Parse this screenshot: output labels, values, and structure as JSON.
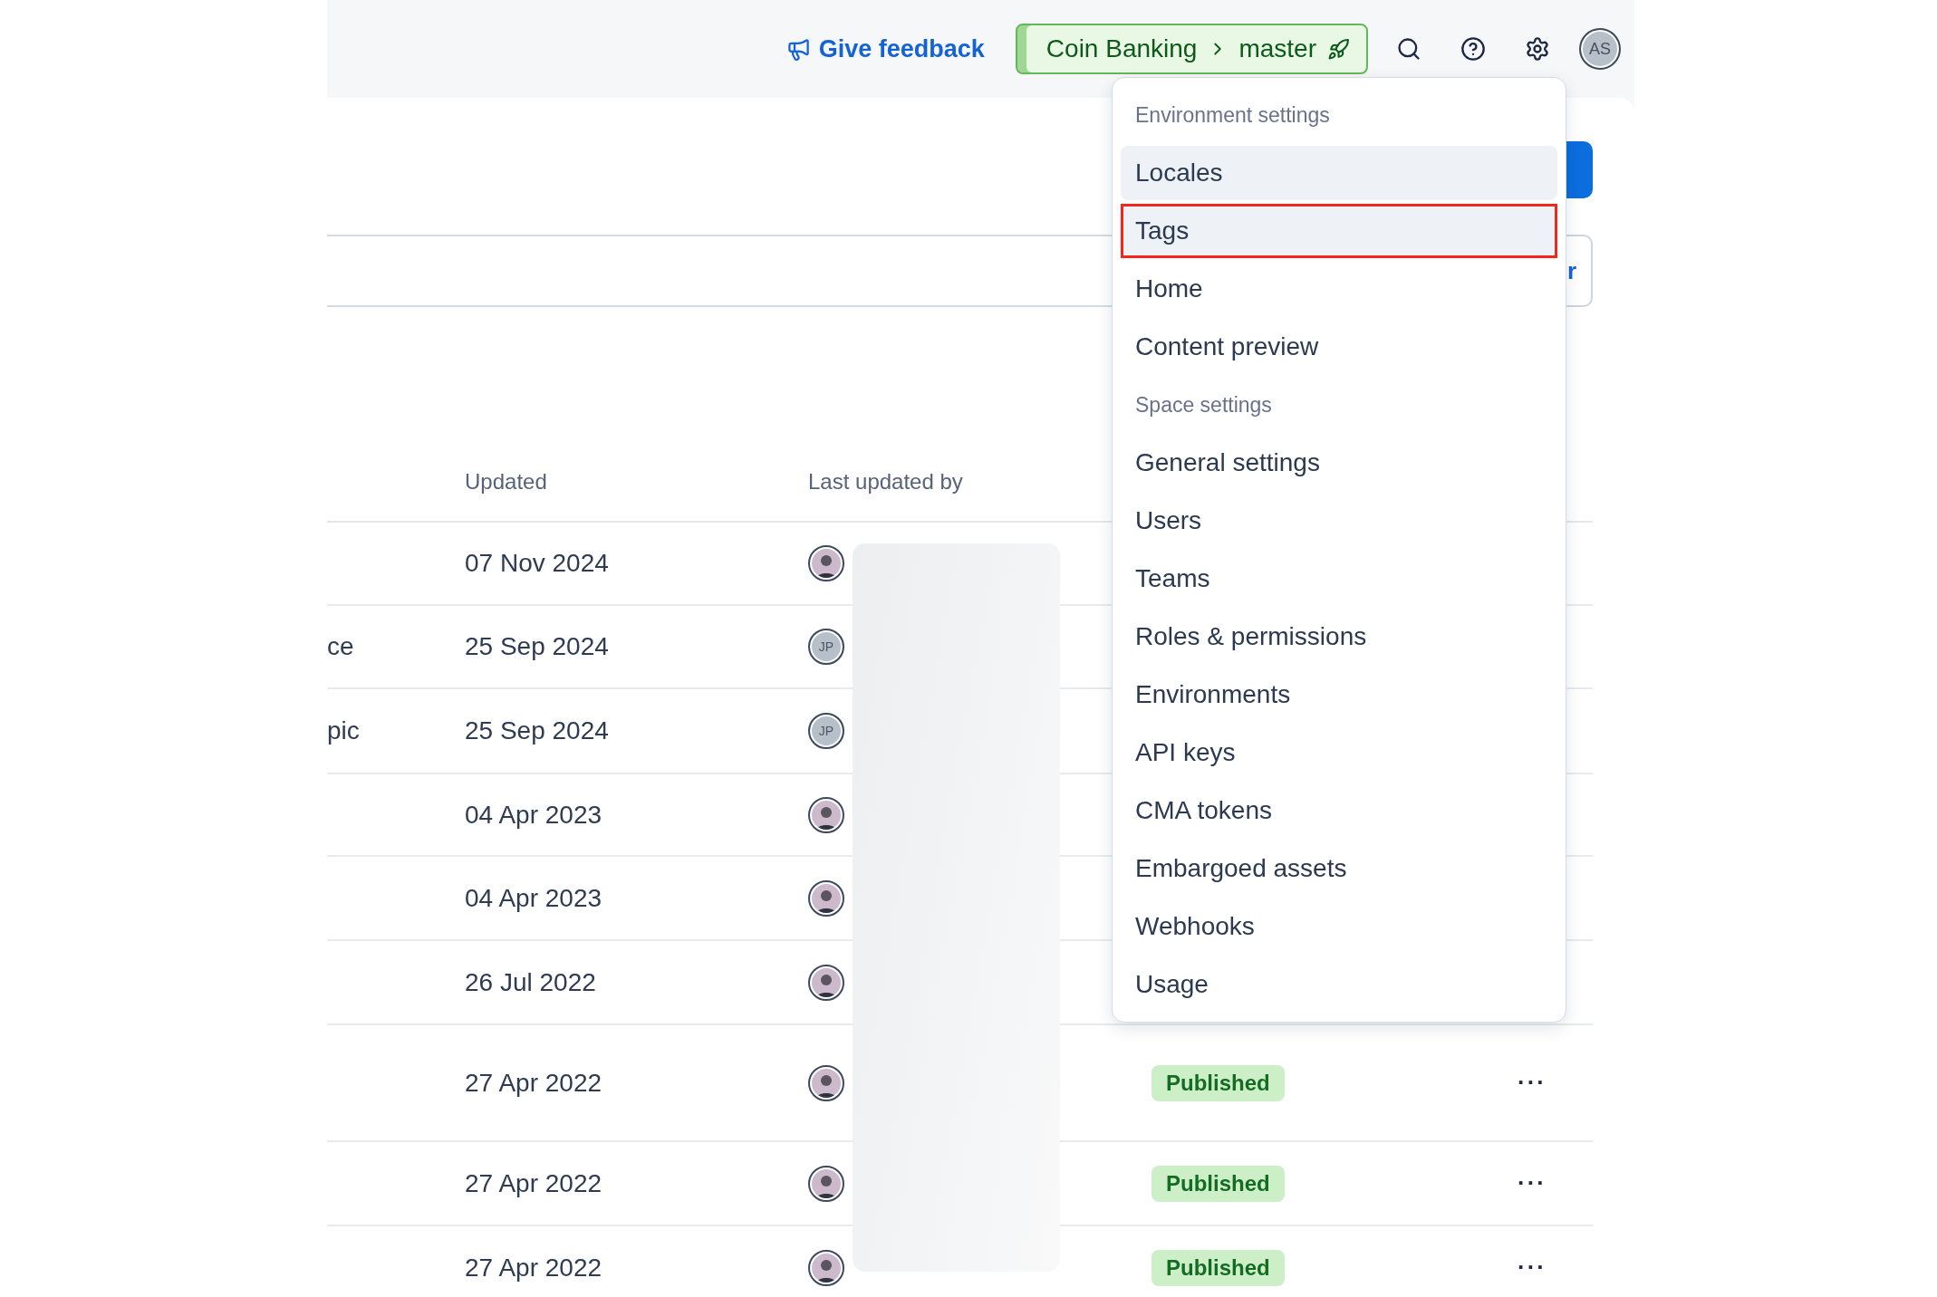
{
  "top_bar": {
    "feedback_link": "Give feedback",
    "environment_switcher": {
      "space": "Coin Banking",
      "environment": "master"
    },
    "user_avatar": "AS"
  },
  "page_actions": {
    "secondary_button": "r"
  },
  "table": {
    "columns": [
      {
        "label": "Updated"
      },
      {
        "label": "Last updated by"
      }
    ],
    "rows": [
      {
        "updated": "07 Nov 2024",
        "avatar": {
          "kind": "photo"
        }
      },
      {
        "column_1": "ce",
        "updated": "25 Sep 2024",
        "avatar": {
          "kind": "initials",
          "initials": "JP"
        }
      },
      {
        "column_1": "pic",
        "updated": "25 Sep 2024",
        "avatar": {
          "kind": "initials",
          "initials": "JP"
        }
      },
      {
        "updated": "04 Apr 2023",
        "avatar": {
          "kind": "photo"
        }
      },
      {
        "updated": "04 Apr 2023",
        "avatar": {
          "kind": "photo"
        }
      },
      {
        "updated": "26 Jul 2022",
        "avatar": {
          "kind": "photo"
        }
      },
      {
        "updated": "27 Apr 2022",
        "avatar": {
          "kind": "photo"
        },
        "status": "Published",
        "actions": "···"
      },
      {
        "updated": "27 Apr 2022",
        "avatar": {
          "kind": "photo"
        },
        "status": "Published",
        "actions": "···"
      },
      {
        "updated": "27 Apr 2022",
        "avatar": {
          "kind": "photo"
        },
        "status": "Published",
        "actions": "···"
      }
    ]
  },
  "settings_menu": {
    "sections": [
      {
        "heading": "Environment settings",
        "items": [
          {
            "label": "Locales",
            "highlighted": true,
            "callout": false
          },
          {
            "label": "Tags",
            "highlighted": true,
            "callout": true
          },
          {
            "label": "Home",
            "highlighted": false,
            "callout": false
          },
          {
            "label": "Content preview",
            "highlighted": false,
            "callout": false
          }
        ]
      },
      {
        "heading": "Space settings",
        "items": [
          {
            "label": "General settings",
            "highlighted": false,
            "callout": false
          },
          {
            "label": "Users",
            "highlighted": false,
            "callout": false
          },
          {
            "label": "Teams",
            "highlighted": false,
            "callout": false
          },
          {
            "label": "Roles & permissions",
            "highlighted": false,
            "callout": false
          },
          {
            "label": "Environments",
            "highlighted": false,
            "callout": false
          },
          {
            "label": "API keys",
            "highlighted": false,
            "callout": false
          },
          {
            "label": "CMA tokens",
            "highlighted": false,
            "callout": false
          },
          {
            "label": "Embargoed assets",
            "highlighted": false,
            "callout": false
          },
          {
            "label": "Webhooks",
            "highlighted": false,
            "callout": false
          },
          {
            "label": "Usage",
            "highlighted": false,
            "callout": false
          }
        ]
      }
    ]
  }
}
